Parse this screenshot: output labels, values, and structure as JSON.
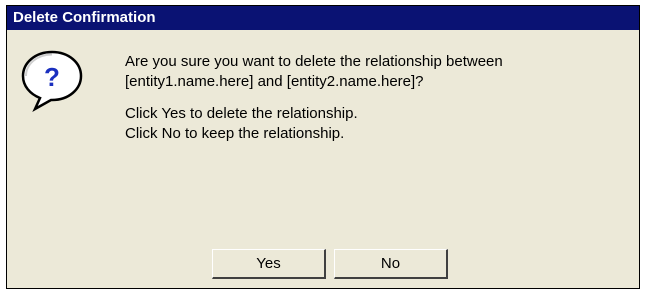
{
  "dialog": {
    "title": "Delete Confirmation",
    "icon": "question-icon",
    "icon_glyph": "?",
    "message_line1": "Are you sure you want to delete the relationship between",
    "message_line2": "[entity1.name.here] and [entity2.name.here]?",
    "instruction_yes": "Click Yes to delete the relationship.",
    "instruction_no": "Click No to keep the relationship.",
    "buttons": {
      "yes_label": "Yes",
      "no_label": "No"
    }
  },
  "colors": {
    "titlebar": "#0a1273",
    "dialog_background": "#ece9d8",
    "icon_glyph": "#1a2fbf"
  }
}
